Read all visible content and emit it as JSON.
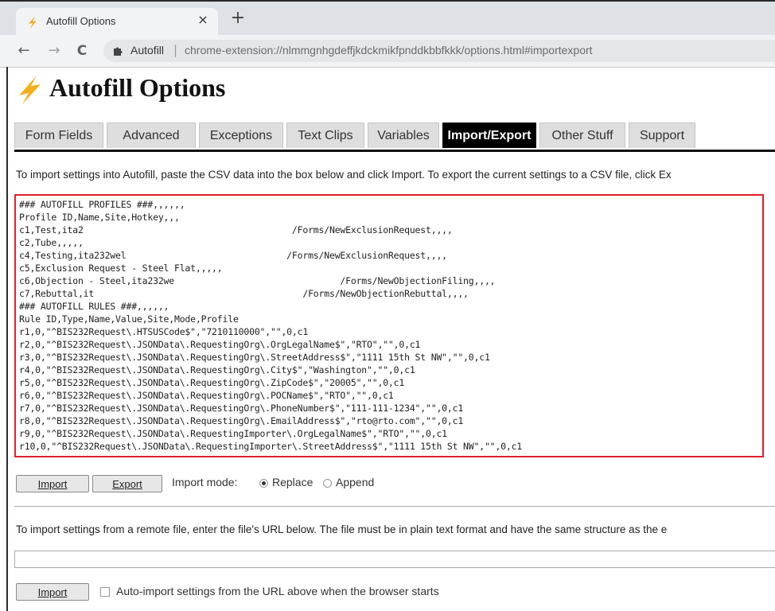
{
  "browser": {
    "tab_title": "Autofill Options",
    "tab_close": "×",
    "new_tab": "+",
    "omnibox_ext_name": "Autofill",
    "omnibox_separator": "|",
    "omnibox_url": "chrome-extension://nlmmgnhgdeffjkdckmikfpnddkbbfkkk/options.html#importexport",
    "back": "←",
    "forward": "→",
    "reload": "C"
  },
  "page": {
    "title": "Autofill Options",
    "accent_color": "#f2b01e",
    "tabs": [
      {
        "label": "Form Fields",
        "active": false
      },
      {
        "label": "Advanced",
        "active": false
      },
      {
        "label": "Exceptions",
        "active": false
      },
      {
        "label": "Text Clips",
        "active": false
      },
      {
        "label": "Variables",
        "active": false
      },
      {
        "label": "Import/Export",
        "active": true
      },
      {
        "label": "Other Stuff",
        "active": false
      },
      {
        "label": "Support",
        "active": false
      }
    ],
    "import_description": "To import settings into Autofill, paste the CSV data into the box below and click Import. To export the current settings to a CSV file, click Ex",
    "csv_lines": [
      "### AUTOFILL PROFILES ###,,,,,,",
      "Profile ID,Name,Site,Hotkey,,,",
      "c1,Test,ita2                                       /Forms/NewExclusionRequest,,,,",
      "c2,Tube,,,,,",
      "c4,Testing,ita232wel                              /Forms/NewExclusionRequest,,,,",
      "c5,Exclusion Request - Steel Flat,,,,,",
      "c6,Objection - Steel,ita232we                               /Forms/NewObjectionFiling,,,,",
      "c7,Rebuttal,it                                       /Forms/NewObjectionRebuttal,,,,",
      "### AUTOFILL RULES ###,,,,,,",
      "Rule ID,Type,Name,Value,Site,Mode,Profile",
      "r1,0,\"^BIS232Request\\.HTSUSCode$\",\"7210110000\",\"\",0,c1",
      "r2,0,\"^BIS232Request\\.JSONData\\.RequestingOrg\\.OrgLegalName$\",\"RTO\",\"\",0,c1",
      "r3,0,\"^BIS232Request\\.JSONData\\.RequestingOrg\\.StreetAddress$\",\"1111 15th St NW\",\"\",0,c1",
      "r4,0,\"^BIS232Request\\.JSONData\\.RequestingOrg\\.City$\",\"Washington\",\"\",0,c1",
      "r5,0,\"^BIS232Request\\.JSONData\\.RequestingOrg\\.ZipCode$\",\"20005\",\"\",0,c1",
      "r6,0,\"^BIS232Request\\.JSONData\\.RequestingOrg\\.POCName$\",\"RTO\",\"\",0,c1",
      "r7,0,\"^BIS232Request\\.JSONData\\.RequestingOrg\\.PhoneNumber$\",\"111-111-1234\",\"\",0,c1",
      "r8,0,\"^BIS232Request\\.JSONData\\.RequestingOrg\\.EmailAddress$\",\"rto@rto.com\",\"\",0,c1",
      "r9,0,\"^BIS232Request\\.JSONData\\.RequestingImporter\\.OrgLegalName$\",\"RTO\",\"\",0,c1",
      "r10,0,\"^BIS232Request\\.JSONData\\.RequestingImporter\\.StreetAddress$\",\"1111 15th St NW\",\"\",0,c1"
    ],
    "import_button": "Import",
    "export_button": "Export",
    "import_mode_label": "Import mode:",
    "mode_replace": "Replace",
    "mode_append": "Append",
    "mode_selected": "Replace",
    "remote_description": "To import settings from a remote file, enter the file's URL below. The file must be in plain text format and have the same structure as the e",
    "remote_url_value": "",
    "remote_import_button": "Import",
    "auto_import_label": "Auto-import settings from the URL above when the browser starts",
    "auto_import_checked": false
  }
}
